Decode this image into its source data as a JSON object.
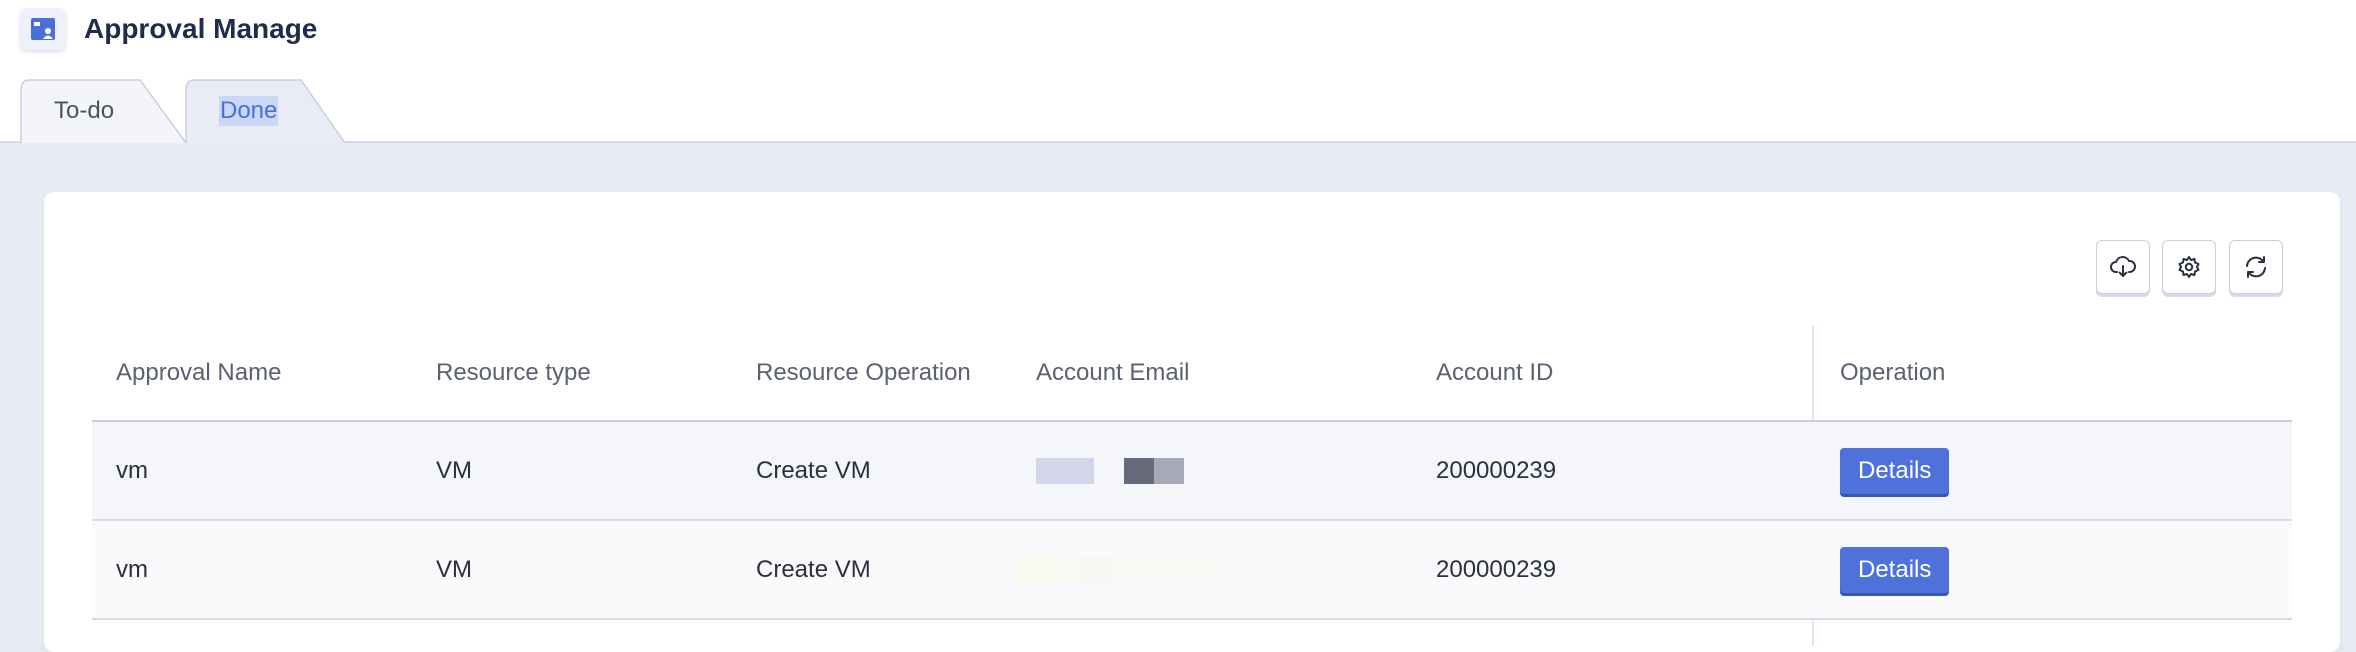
{
  "app": {
    "title": "Approval Manage",
    "logo_icon": "approval-manage-icon",
    "accent_color": "#4e72d9"
  },
  "tabs": [
    {
      "label": "To-do",
      "active": false
    },
    {
      "label": "Done",
      "active": true
    }
  ],
  "toolbar": {
    "buttons": [
      {
        "name": "download",
        "icon": "cloud-download-icon"
      },
      {
        "name": "settings",
        "icon": "gear-icon"
      },
      {
        "name": "refresh",
        "icon": "refresh-icon"
      }
    ]
  },
  "table": {
    "columns": [
      "Approval Name",
      "Resource type",
      "Resource Operation",
      "Account Email",
      "Account ID",
      "Operation"
    ],
    "rows": [
      {
        "approval_name": "vm",
        "resource_type": "VM",
        "resource_operation": "Create VM",
        "account_email": "",
        "account_id": "200000239",
        "operation": "Details"
      },
      {
        "approval_name": "vm",
        "resource_type": "VM",
        "resource_operation": "Create VM",
        "account_email": "",
        "account_id": "200000239",
        "operation": "Details"
      }
    ]
  }
}
